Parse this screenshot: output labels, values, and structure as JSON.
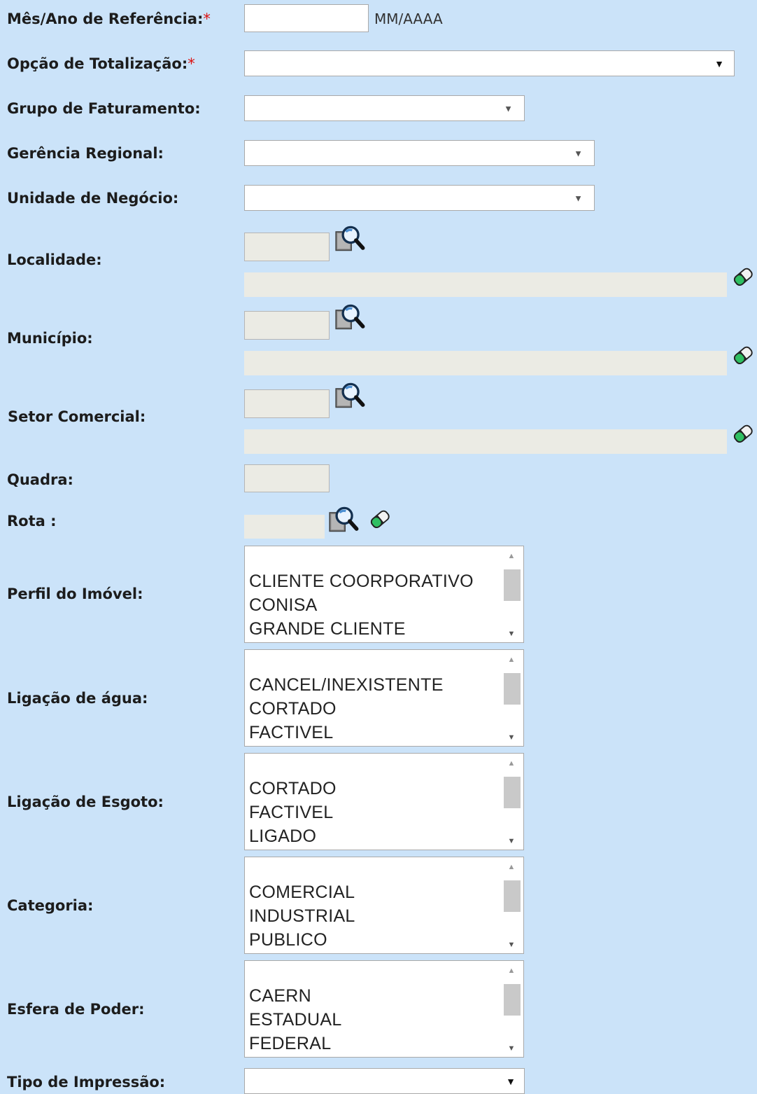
{
  "fields": {
    "mes_ano": {
      "label": "Mês/Ano de Referência:",
      "required_mark": "*",
      "value": "",
      "hint": "MM/AAAA"
    },
    "opcao_totalizacao": {
      "label": "Opção de Totalização:",
      "required_mark": "*",
      "selected": ""
    },
    "grupo_faturamento": {
      "label": "Grupo de Faturamento:",
      "selected": ""
    },
    "gerencia_regional": {
      "label": "Gerência Regional:",
      "selected": ""
    },
    "unidade_negocio": {
      "label": "Unidade de Negócio:",
      "selected": ""
    },
    "localidade": {
      "label": "Localidade:",
      "code": "",
      "description": ""
    },
    "municipio": {
      "label": "Município:",
      "code": "",
      "description": ""
    },
    "setor_comercial": {
      "label": "Setor Comercial:",
      "code": "",
      "description": ""
    },
    "quadra": {
      "label": "Quadra:",
      "value": ""
    },
    "rota": {
      "label": "Rota :",
      "value": ""
    },
    "perfil_imovel": {
      "label": "Perfil do Imóvel:",
      "options": [
        "CLIENTE COORPORATIVO",
        "CONISA",
        "GRANDE CLIENTE"
      ]
    },
    "ligacao_agua": {
      "label": "Ligação de água:",
      "options": [
        "CANCEL/INEXISTENTE",
        "CORTADO",
        "FACTIVEL"
      ]
    },
    "ligacao_esgoto": {
      "label": "Ligação de Esgoto:",
      "options": [
        "CORTADO",
        "FACTIVEL",
        "LIGADO"
      ]
    },
    "categoria": {
      "label": "Categoria:",
      "options": [
        "COMERCIAL",
        "INDUSTRIAL",
        "PUBLICO"
      ]
    },
    "esfera_poder": {
      "label": "Esfera de Poder:",
      "options": [
        "CAERN",
        "ESTADUAL",
        "FEDERAL"
      ]
    },
    "tipo_impressao": {
      "label": "Tipo de Impressão:",
      "selected": ""
    }
  },
  "icons": {
    "search": "magnifier-search-icon",
    "clear": "eraser-icon"
  },
  "colors": {
    "background": "#cbe3f9",
    "required": "#dd1111",
    "readonly_field": "#ebebe4"
  }
}
